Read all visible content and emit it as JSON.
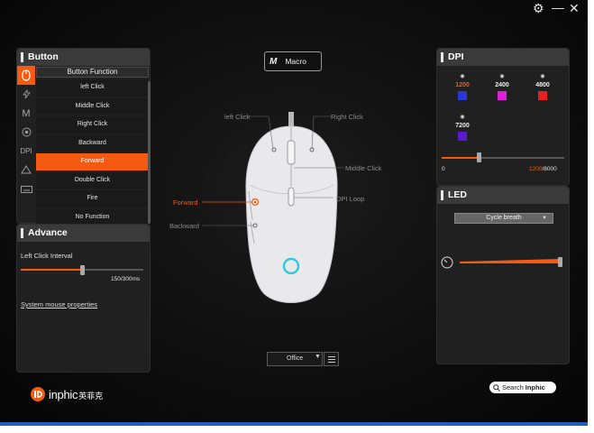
{
  "titlebar": {
    "settings_icon": "gear-icon",
    "minimize_icon": "minimize-icon",
    "close_icon": "close-icon"
  },
  "button_panel": {
    "title": "Button",
    "column_header": "Button Function",
    "tabs": [
      "mouse-icon",
      "lightning-icon",
      "macro-m-icon",
      "record-icon",
      "dpi-text",
      "alert-icon",
      "keyboard-icon"
    ],
    "dpi_tab_label": "DPI",
    "functions": [
      "left Click",
      "Middle Click",
      "Right Click",
      "Backward",
      "Forward",
      "Double Click",
      "Fire",
      "No Function"
    ],
    "selected_function": "Forward"
  },
  "advance_panel": {
    "title": "Advance",
    "interval_label": "Left Click Interval",
    "interval_value": "150/300ms",
    "interval_fraction": 0.5,
    "link": "System mouse properties"
  },
  "center": {
    "macro_icon": "M",
    "macro_label": "Macro",
    "callouts": {
      "left_click": "left Click",
      "right_click": "Right Click",
      "middle_click": "Middle Click",
      "forward": "Forward",
      "dpi_loop": "DPI Loop",
      "backward": "Backward"
    },
    "profile": "Office"
  },
  "dpi_panel": {
    "title": "DPI",
    "stages": [
      {
        "value": "1200",
        "color": "#2a36d6",
        "current": true
      },
      {
        "value": "2400",
        "color": "#e020d8",
        "current": false
      },
      {
        "value": "4800",
        "color": "#e62020",
        "current": false
      },
      {
        "value": "7200",
        "color": "#5a1ad0",
        "current": false
      }
    ],
    "slider_min": "0",
    "slider_current": "1200",
    "slider_max": "/8000",
    "slider_fraction": 0.3
  },
  "led_panel": {
    "title": "LED",
    "effect": "Cycle breath",
    "speed_icon": "speedometer-icon",
    "speed_fraction": 1.0
  },
  "brand": {
    "name": "inphic",
    "name_cn": "英菲克"
  },
  "search": {
    "prefix": "Search",
    "name": "Inphic"
  },
  "colors": {
    "accent": "#f55a10",
    "panel_header": "#3a3a3a",
    "panel_body": "#202020"
  }
}
